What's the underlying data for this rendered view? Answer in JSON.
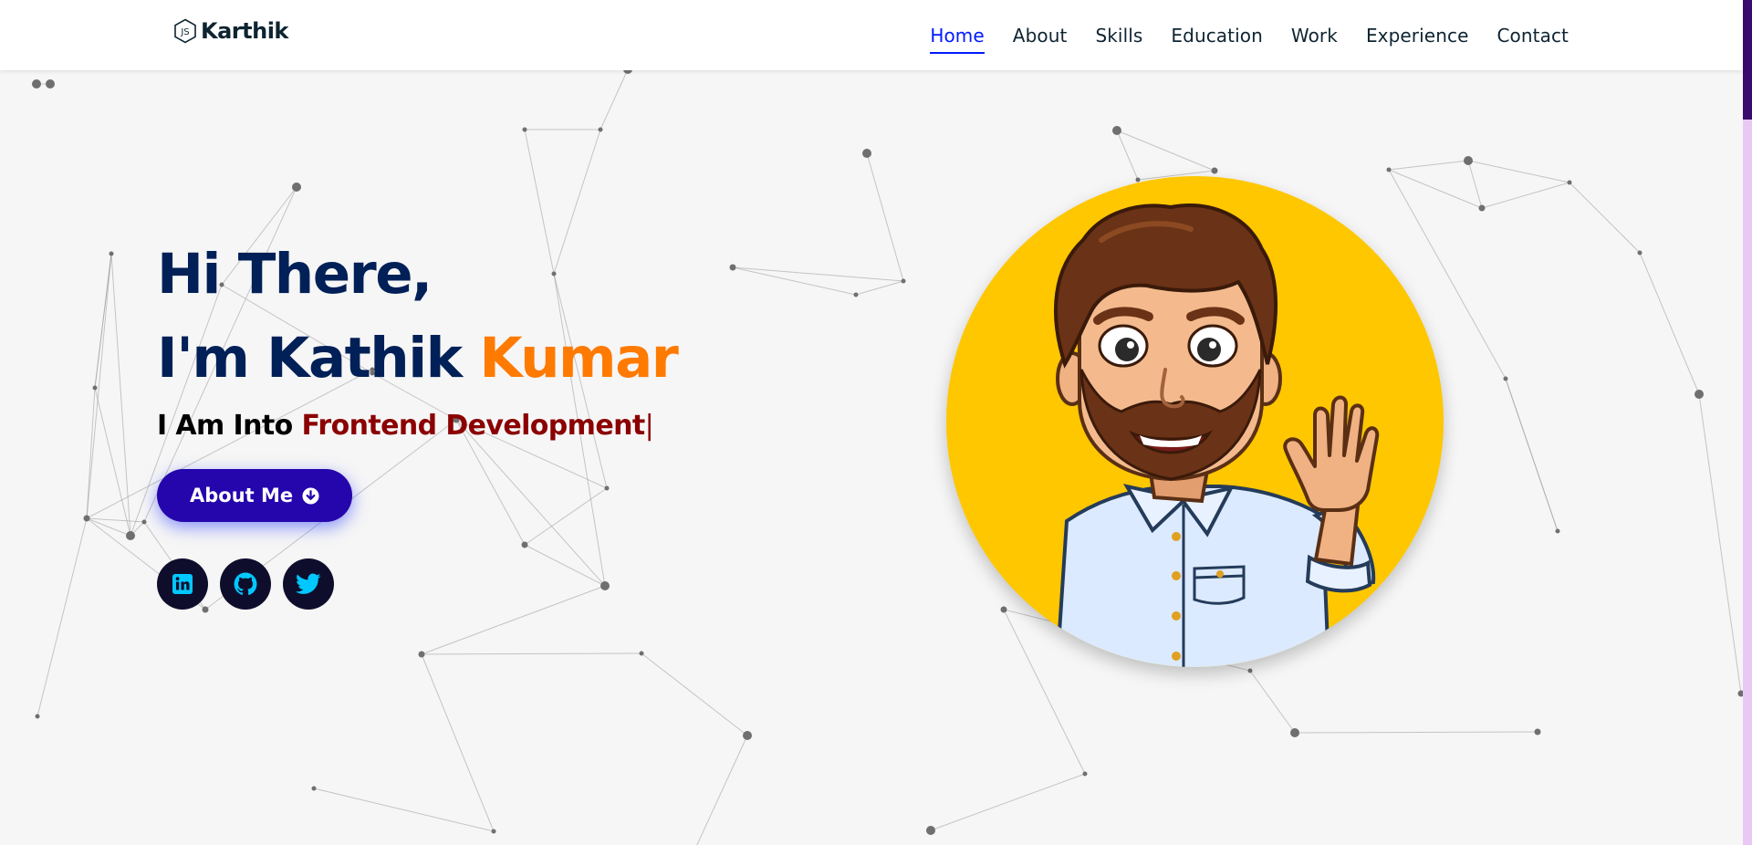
{
  "brand": {
    "name": "Karthik",
    "logo_icon": "js-hexagon-icon"
  },
  "nav": {
    "items": [
      {
        "label": "Home",
        "active": true
      },
      {
        "label": "About",
        "active": false
      },
      {
        "label": "Skills",
        "active": false
      },
      {
        "label": "Education",
        "active": false
      },
      {
        "label": "Work",
        "active": false
      },
      {
        "label": "Experience",
        "active": false
      },
      {
        "label": "Contact",
        "active": false
      }
    ]
  },
  "hero": {
    "greeting_line1": "Hi There,",
    "greeting_line2_prefix": "I'm Kathik ",
    "greeting_line2_accent": "Kumar",
    "typed_prefix": "I Am Into ",
    "typed_text": "Frontend Development",
    "typed_cursor": "|",
    "cta_label": "About Me",
    "cta_icon": "arrow-circle-down-icon",
    "avatar": "waving-bitmoji-avatar"
  },
  "socials": [
    {
      "name": "linkedin",
      "icon": "linkedin-icon"
    },
    {
      "name": "github",
      "icon": "github-icon"
    },
    {
      "name": "twitter",
      "icon": "twitter-icon"
    }
  ],
  "colors": {
    "nav_text": "#0e2431",
    "nav_active": "#011aff",
    "heading": "#002057",
    "accent": "#ff7a00",
    "typed_accent": "#8b0000",
    "cta_bg": "#2506ad",
    "social_bg": "#0e0e2c",
    "social_icon": "#00c8ff",
    "avatar_bg": "#ffc700",
    "page_bg": "#f6f6f6"
  }
}
